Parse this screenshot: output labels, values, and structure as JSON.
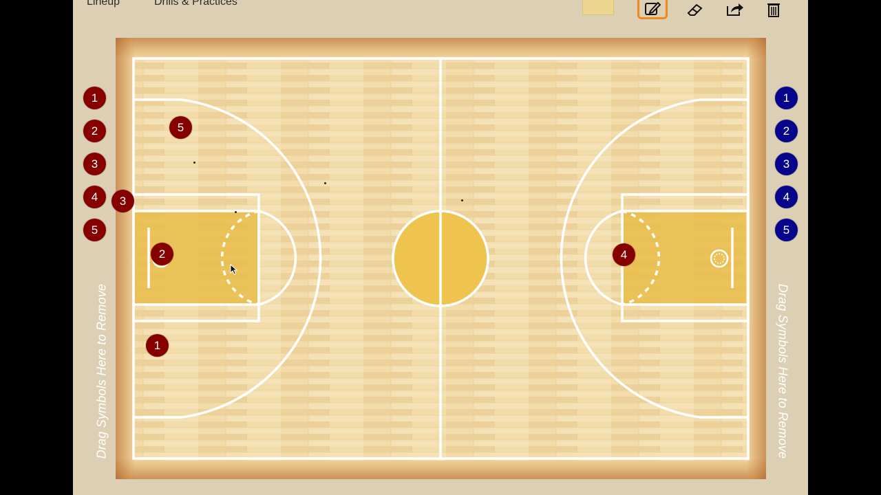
{
  "menu": {
    "lineup": "Lineup",
    "drills": "Drills & Practices"
  },
  "toolbar": {
    "icons": [
      "playbook-thumbnail",
      "edit-icon",
      "eraser-icon",
      "share-icon",
      "trash-icon"
    ],
    "accent": "#f08a1c"
  },
  "bench": {
    "red": [
      "1",
      "2",
      "3",
      "4",
      "5"
    ],
    "blue": [
      "1",
      "2",
      "3",
      "4",
      "5"
    ]
  },
  "court_players": {
    "red_5": "5",
    "red_3": "3",
    "red_2": "2",
    "red_1": "1",
    "red_4": "4"
  },
  "remove_zone": {
    "left": "Drag Symbols Here to Remove",
    "right": "Drag Symbols Here to Remove"
  },
  "colors": {
    "team_red": "#860000",
    "team_blue": "#06068a",
    "court_wood": "#efd8a4",
    "paint": "#e7b63c"
  }
}
